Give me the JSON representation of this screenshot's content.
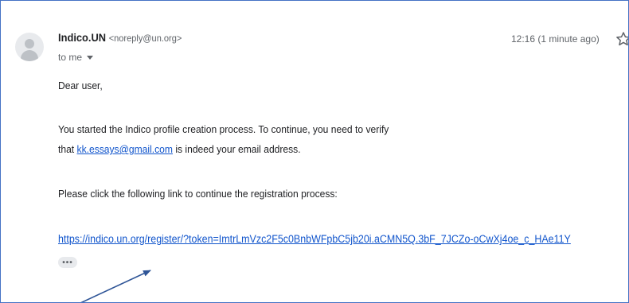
{
  "sender": {
    "name": "Indico.UN",
    "email": "<noreply@un.org>"
  },
  "recipient": {
    "to_label": "to me"
  },
  "timestamp": "12:16 (1 minute ago)",
  "message": {
    "greeting": "Dear user,",
    "paragraph1_line1": "You started the Indico profile creation process. To continue, you need to verify",
    "paragraph1_prefix": "that ",
    "user_email": "kk.essays@gmail.com",
    "paragraph1_suffix": " is indeed your email address.",
    "paragraph2": "Please click the following link to continue the registration process:",
    "registration_link": "https://indico.un.org/register/?token=ImtrLmVzc2F5c0BnbWFpbC5jb20i.aCMN5Q.3bF_7JCZo-oCwXj4oe_c_HAe11Y",
    "more_label": "•••"
  },
  "colors": {
    "link": "#1155cc",
    "annotation_arrow": "#2f5597",
    "frame_border": "#4472c4"
  },
  "icons": {
    "avatar": "default-avatar-icon",
    "star": "star-outline-icon",
    "caret": "caret-down-icon"
  }
}
